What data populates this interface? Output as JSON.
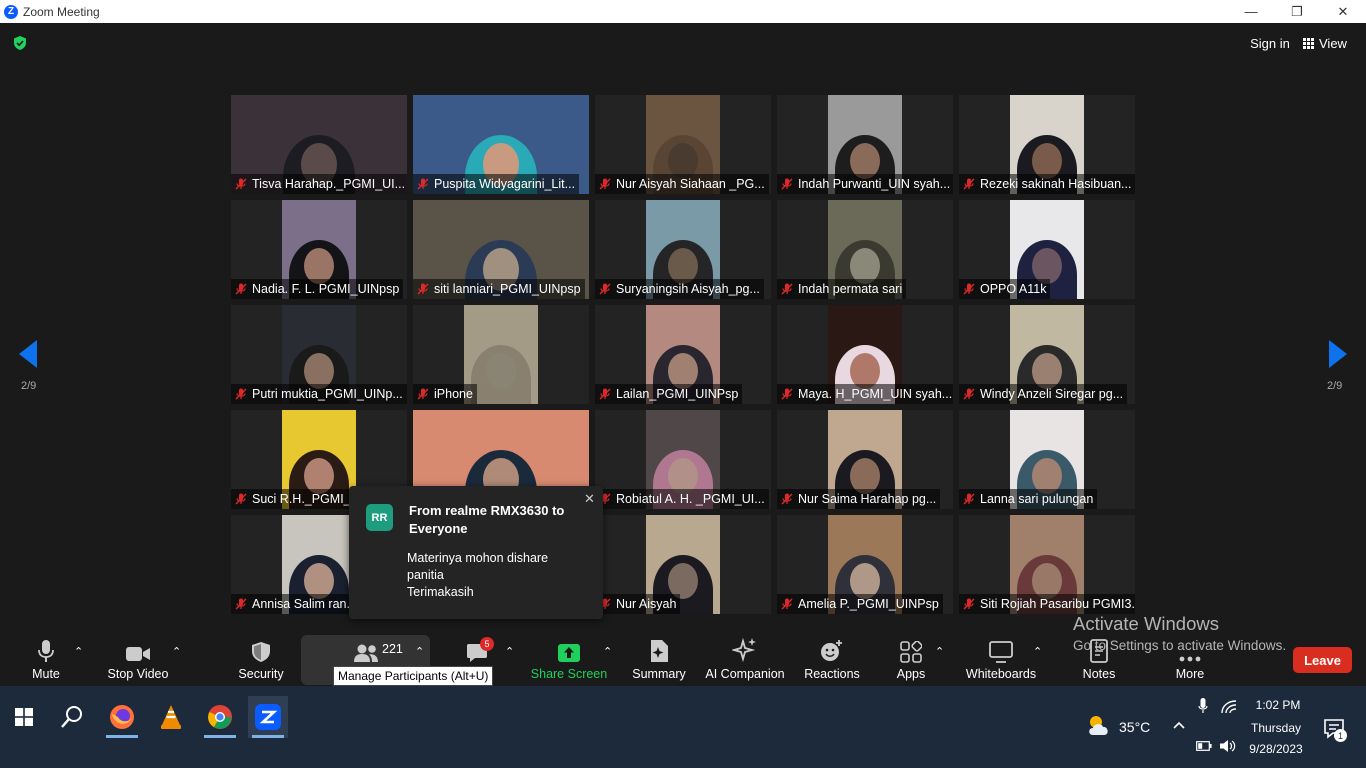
{
  "window": {
    "title": "Zoom Meeting",
    "minimize": "—",
    "restore": "❐",
    "close": "✕"
  },
  "header": {
    "sign_in": "Sign in",
    "view": "View"
  },
  "nav": {
    "page_left": "2/9",
    "page_right": "2/9"
  },
  "participants": [
    {
      "name": "Tisva Harahap._PGMI_UI...",
      "skin": "#5a4a4a",
      "bg": "#3a3238",
      "scarf": "#1c1c22",
      "vw": 176
    },
    {
      "name": "Puspita Widyagarini_Lit...",
      "skin": "#c89a80",
      "bg": "#3b5a8a",
      "scarf": "#2aa9b6",
      "vw": 176
    },
    {
      "name": "Nur Aisyah Siahaan _PG...",
      "skin": "#4a3b30",
      "bg": "#6b5440",
      "scarf": "#5a4535",
      "vw": 74
    },
    {
      "name": "Indah Purwanti_UIN syah...",
      "skin": "#8a6a58",
      "bg": "#9a9a9a",
      "scarf": "#1d1d1d",
      "vw": 74
    },
    {
      "name": "Rezeki sakinah Hasibuan...",
      "skin": "#7a5a4a",
      "bg": "#d8d4cc",
      "scarf": "#1a1a20",
      "vw": 74
    },
    {
      "name": "Nadia. F. L. PGMI_UINpsp",
      "skin": "#9a7565",
      "bg": "#7b6f8a",
      "scarf": "#141418",
      "vw": 74
    },
    {
      "name": "siti lanniari_PGMI_UINpsp",
      "skin": "#a09080",
      "bg": "#5a5448",
      "scarf": "#2b3a55",
      "vw": 176
    },
    {
      "name": "Suryaningsih Aisyah_pg...",
      "skin": "#6a5a4a",
      "bg": "#7a9aa8",
      "scarf": "#252528",
      "vw": 74
    },
    {
      "name": "Indah permata sari",
      "skin": "#8a8878",
      "bg": "#6b6a58",
      "scarf": "#3a3a30",
      "vw": 74
    },
    {
      "name": "OPPO A11k",
      "skin": "#6a5560",
      "bg": "#e8e8ea",
      "scarf": "#1e2240",
      "vw": 74
    },
    {
      "name": "Putri muktia_PGMI_UINp...",
      "skin": "#8a7060",
      "bg": "#2a2c34",
      "scarf": "#1a1a1a",
      "vw": 74
    },
    {
      "name": "iPhone",
      "skin": "#8a8475",
      "bg": "#a49b86",
      "scarf": "#8a8070",
      "vw": 74
    },
    {
      "name": "Lailan_PGMI_UINPsp",
      "skin": "#a08070",
      "bg": "#b48a80",
      "scarf": "#2a2630",
      "vw": 74
    },
    {
      "name": "Maya. H_PGMI_UIN syah...",
      "skin": "#b07868",
      "bg": "#2a1814",
      "scarf": "#e8d8e0",
      "vw": 74
    },
    {
      "name": "Windy Anzeli Siregar pg...",
      "skin": "#9a8070",
      "bg": "#c0b8a0",
      "scarf": "#2a2a2a",
      "vw": 74
    },
    {
      "name": "Suci R.H._PGMI_U...",
      "skin": "#b08070",
      "bg": "#e8c830",
      "scarf": "#2a1c14",
      "vw": 74
    },
    {
      "name": "",
      "skin": "#b08a78",
      "bg": "#d88a70",
      "scarf": "#1a2a3a",
      "vw": 176
    },
    {
      "name": "Robiatul A. H. _PGMI_UI...",
      "skin": "#b09088",
      "bg": "#504848",
      "scarf": "#b07890",
      "vw": 74
    },
    {
      "name": "Nur Saima Harahap pg...",
      "skin": "#8a6a58",
      "bg": "#c0a890",
      "scarf": "#1a1a20",
      "vw": 74
    },
    {
      "name": "Lanna sari pulungan",
      "skin": "#a08070",
      "bg": "#e8e4e4",
      "scarf": "#3a5a6a",
      "vw": 74
    },
    {
      "name": "Annisa Salim ran...",
      "skin": "#b09080",
      "bg": "#c8c4be",
      "scarf": "#1a2030",
      "vw": 74
    },
    {
      "name": "",
      "skin": "#a08878",
      "bg": "#505050",
      "scarf": "#303030",
      "vw": 176
    },
    {
      "name": "Nur Aisyah",
      "skin": "#7a6a60",
      "bg": "#b8a890",
      "scarf": "#1a1a20",
      "vw": 74
    },
    {
      "name": "Amelia P._PGMI_UINPsp",
      "skin": "#b09888",
      "bg": "#9a7858",
      "scarf": "#30303a",
      "vw": 74
    },
    {
      "name": "Siti Rojiah Pasaribu PGMI3....",
      "skin": "#9a7868",
      "bg": "#a0806a",
      "scarf": "#6a3a3a",
      "vw": 74
    }
  ],
  "chat_popup": {
    "avatar": "RR",
    "from": "From realme RMX3630 to Everyone",
    "message_line1": "Materinya mohon dishare",
    "message_line2": "panitia",
    "message_line3": "Terimakasih",
    "close": "✕"
  },
  "toolbar": {
    "mute": "Mute",
    "stop_video": "Stop Video",
    "security": "Security",
    "participants_count": "221",
    "chat_badge": "5",
    "share_screen": "Share Screen",
    "summary": "Summary",
    "ai_companion": "AI Companion",
    "reactions": "Reactions",
    "apps": "Apps",
    "whiteboards": "Whiteboards",
    "notes": "Notes",
    "more": "More",
    "leave": "Leave",
    "tooltip": "Manage Participants (Alt+U)",
    "caret": "⌃"
  },
  "watermark": {
    "line1": "Activate Windows",
    "line2": "Go to Settings to activate Windows."
  },
  "taskbar": {
    "temperature": "35°C",
    "time": "1:02 PM",
    "day": "Thursday",
    "date": "9/28/2023",
    "notification_count": "1"
  },
  "colors": {
    "share_green": "#1fd15c",
    "leave_red": "#d92d20",
    "accent_blue": "#0e72ed",
    "mute_red": "#e02828"
  }
}
